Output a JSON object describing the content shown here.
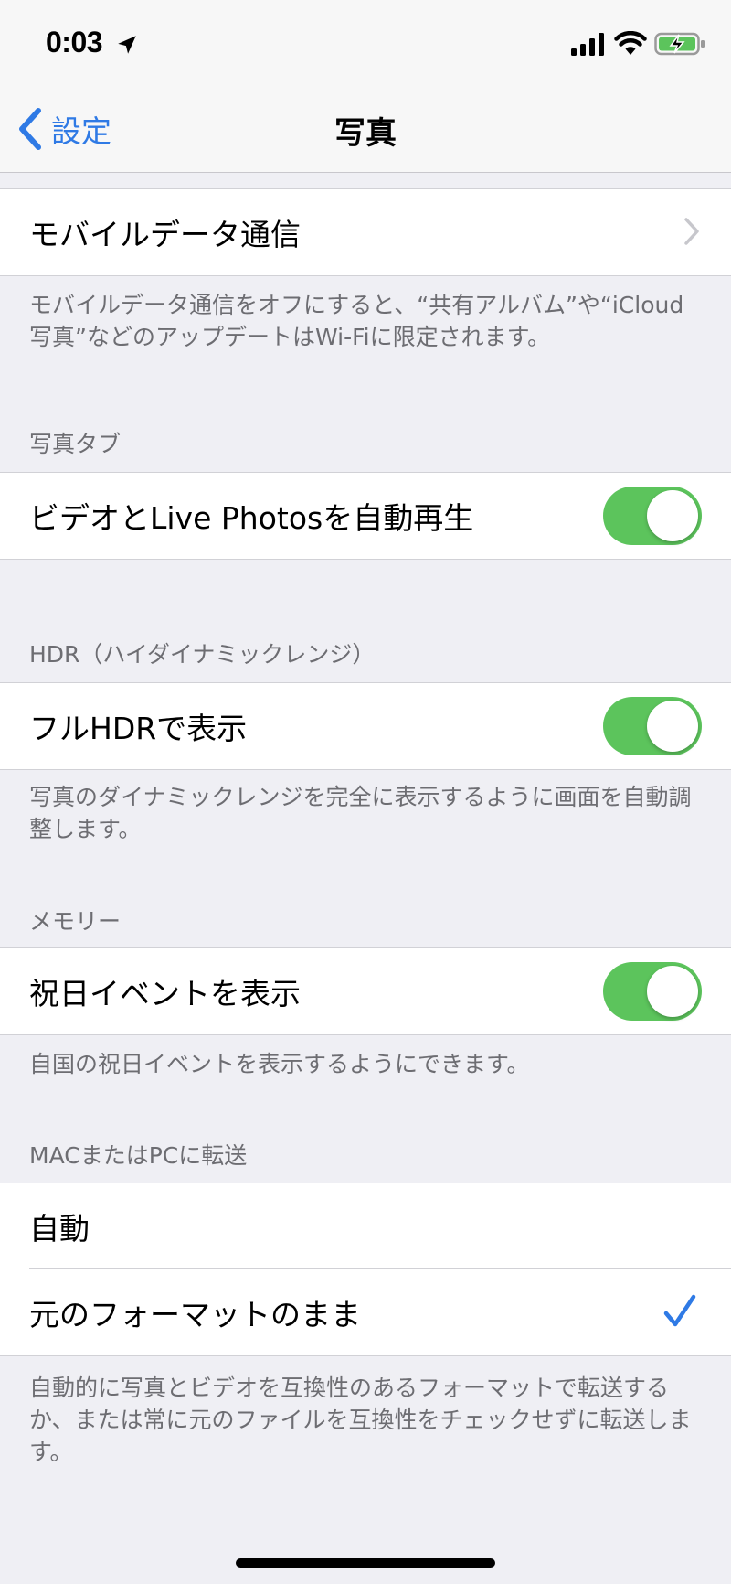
{
  "status_bar": {
    "time": "0:03"
  },
  "nav": {
    "back_label": "設定",
    "title": "写真"
  },
  "cellular": {
    "label": "モバイルデータ通信",
    "footer": "モバイルデータ通信をオフにすると、“共有アルバム”や“iCloud写真”などのアップデートはWi-Fiに限定されます。"
  },
  "photos_tab": {
    "header": "写真タブ",
    "autoplay_label": "ビデオとLive Photosを自動再生",
    "autoplay_on": true
  },
  "hdr": {
    "header": "HDR（ハイダイナミックレンジ）",
    "full_hdr_label": "フルHDRで表示",
    "full_hdr_on": true,
    "footer": "写真のダイナミックレンジを完全に表示するように画面を自動調整します。"
  },
  "memories": {
    "header": "メモリー",
    "holiday_label": "祝日イベントを表示",
    "holiday_on": true,
    "footer": "自国の祝日イベントを表示するようにできます。"
  },
  "transfer": {
    "header": "MACまたはPCに転送",
    "options": [
      "自動",
      "元のフォーマットのまま"
    ],
    "selected": "元のフォーマットのまま",
    "footer": "自動的に写真とビデオを互換性のあるフォーマットで転送するか、または常に元のファイルを互換性をチェックせずに転送します。"
  },
  "colors": {
    "accent": "#2f7ae5",
    "toggle_on": "#5cc45c",
    "footer_text": "#6d6d72",
    "background": "#efeff4"
  },
  "icons": [
    "location-arrow-icon",
    "signal-icon",
    "wifi-icon",
    "battery-charging-icon",
    "back-chevron-icon",
    "chevron-right-icon",
    "checkmark-icon"
  ]
}
